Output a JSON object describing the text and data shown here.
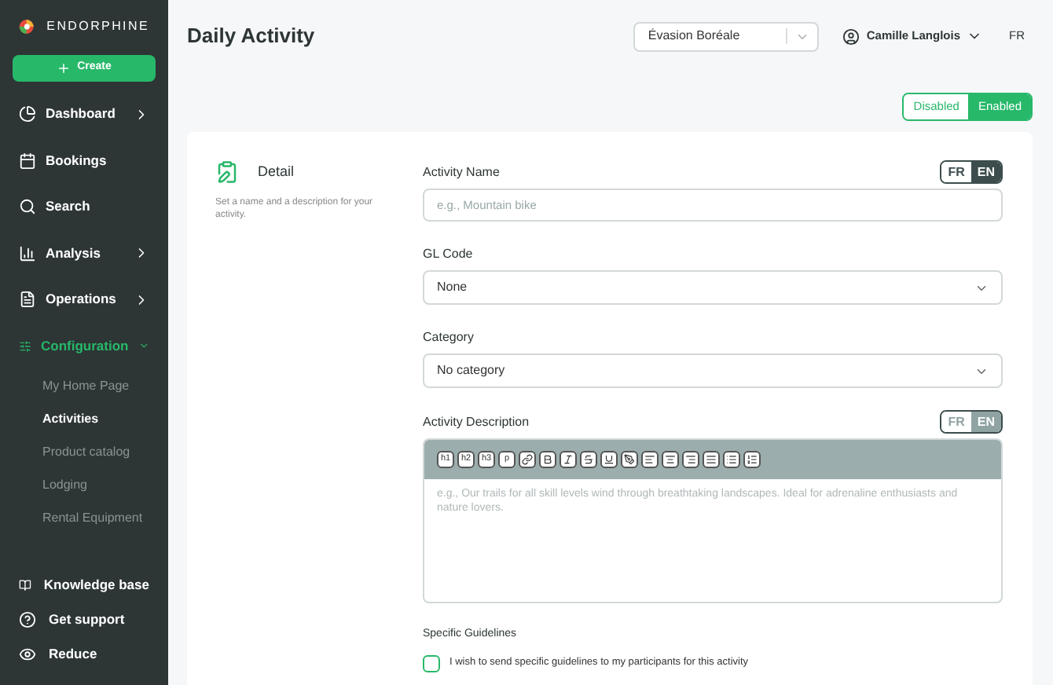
{
  "sidebar": {
    "logo": "ENDORPHINE",
    "create_button": "Create",
    "items": [
      {
        "label": "Dashboard",
        "has_submenu": true,
        "expanded": false,
        "selected": false
      },
      {
        "label": "Bookings",
        "has_submenu": false,
        "selected": false
      },
      {
        "label": "Search",
        "has_submenu": false,
        "selected": false
      },
      {
        "label": "Analysis",
        "has_submenu": true,
        "expanded": false,
        "selected": false
      },
      {
        "label": "Operations",
        "has_submenu": true,
        "expanded": false,
        "selected": false
      },
      {
        "label": "Configuration",
        "has_submenu": true,
        "expanded": true,
        "selected": true,
        "children": [
          {
            "label": "My Home Page",
            "selected": false
          },
          {
            "label": "Activities",
            "selected": true
          },
          {
            "label": "Product catalog",
            "selected": false
          },
          {
            "label": "Lodging",
            "selected": false
          },
          {
            "label": "Rental Equipment",
            "selected": false
          }
        ]
      }
    ],
    "bottom_items": [
      {
        "label": "Knowledge base"
      },
      {
        "label": "Get support"
      },
      {
        "label": "Reduce"
      }
    ]
  },
  "header": {
    "title": "Daily Activity",
    "organization_select": "Évasion Boréale",
    "user": "Camille Langlois",
    "language": "FR"
  },
  "status_toggle": [
    {
      "label": "Disabled",
      "selected": false
    },
    {
      "label": "Enabled",
      "selected": true
    }
  ],
  "section": {
    "title": "Detail",
    "description": "Set a name and a description for your activity."
  },
  "activity_name": {
    "label": "Activity Name",
    "placeholder": "e.g., Mountain bike",
    "languages": [
      {
        "label": "FR",
        "selected": false
      },
      {
        "label": "EN",
        "selected": true
      }
    ],
    "disabled": false
  },
  "gl_code": {
    "label": "GL Code",
    "value": "None"
  },
  "category": {
    "label": "Category",
    "value": "No category"
  },
  "activity_description": {
    "label": "Activity Description",
    "placeholder": "e.g., Our trails for all skill levels wind through breathtaking landscapes. Ideal for adrenaline enthusiasts and nature lovers.",
    "languages": [
      {
        "label": "FR",
        "selected": false
      },
      {
        "label": "EN",
        "selected": true
      }
    ],
    "disabled": true,
    "toolbar_text_buttons": [
      "h1",
      "h2",
      "h3",
      "p"
    ]
  },
  "guidelines": {
    "label": "Specific Guidelines",
    "checkbox_label": "I wish to send specific guidelines to my participants for this activity",
    "checked": false
  }
}
